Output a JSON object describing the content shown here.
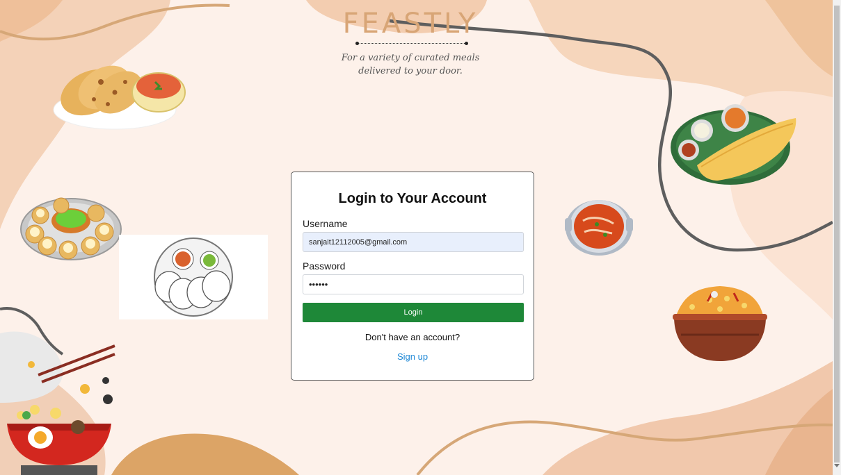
{
  "brand": {
    "name": "FEASTLY",
    "tagline_line1": "For a variety of curated meals",
    "tagline_line2": "delivered to your door."
  },
  "login": {
    "title": "Login to Your Account",
    "username_label": "Username",
    "username_value": "sanjait12112005@gmail.com",
    "password_label": "Password",
    "password_value": "••••••",
    "button_label": "Login",
    "no_account_text": "Don't have an account?",
    "signup_label": "Sign up"
  },
  "icons": {
    "naan": "naan-curry-icon",
    "pani_puri": "pani-puri-icon",
    "idli": "idli-plate-icon",
    "noodles": "noodle-bowl-icon",
    "curry": "curry-pot-icon",
    "dosa": "dosa-plate-icon",
    "biryani": "biryani-pot-icon"
  },
  "colors": {
    "brand": "#d8a576",
    "button": "#1e8838",
    "link": "#1e88d6",
    "background": "#fdf1ea",
    "blob_peach": "#f3cfae",
    "blob_orange": "#e1a86b",
    "curve_gray": "#5e5e5e"
  }
}
